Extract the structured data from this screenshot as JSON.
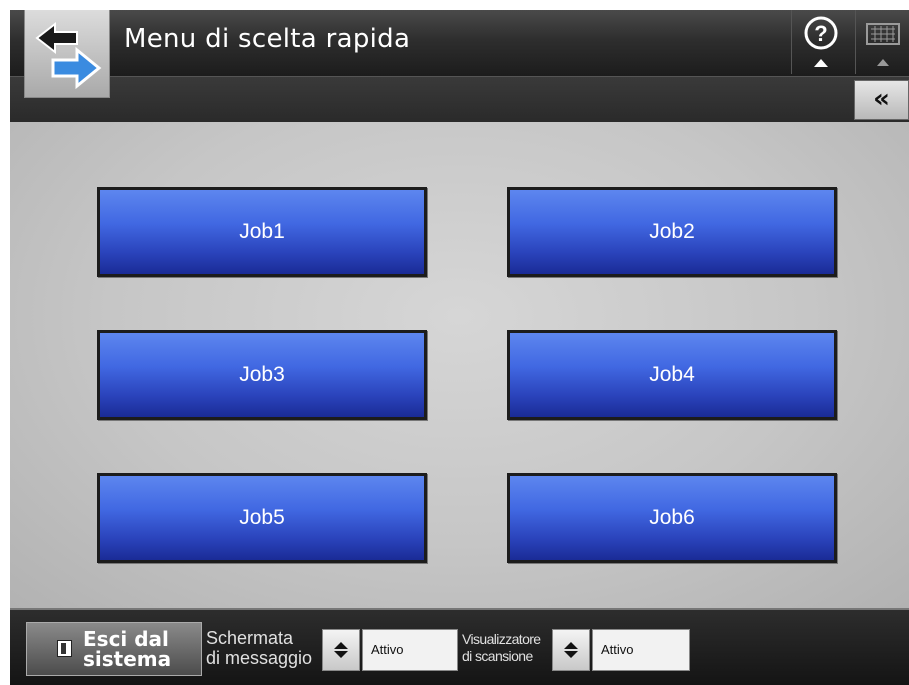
{
  "header": {
    "title": "Menu di scelta rapida",
    "back_icon": "back-forward-arrows-icon",
    "help_icon": "help-icon",
    "keyboard_icon": "keyboard-icon",
    "collapse_label": "«"
  },
  "jobs": [
    {
      "label": "Job1"
    },
    {
      "label": "Job2"
    },
    {
      "label": "Job3"
    },
    {
      "label": "Job4"
    },
    {
      "label": "Job5"
    },
    {
      "label": "Job6"
    }
  ],
  "footer": {
    "logout_line1": "Esci dal",
    "logout_line2": "sistema",
    "message_screen_line1": "Schermata",
    "message_screen_line2": "di messaggio",
    "message_screen_value": "Attivo",
    "scan_viewer_line1": "Visualizzatore",
    "scan_viewer_line2": "di scansione",
    "scan_viewer_value": "Attivo"
  },
  "colors": {
    "job_button_top": "#5d86ef",
    "job_button_bottom": "#1a2b96",
    "header_bg": "#2e2e2e",
    "main_bg": "#c6c6c6"
  }
}
